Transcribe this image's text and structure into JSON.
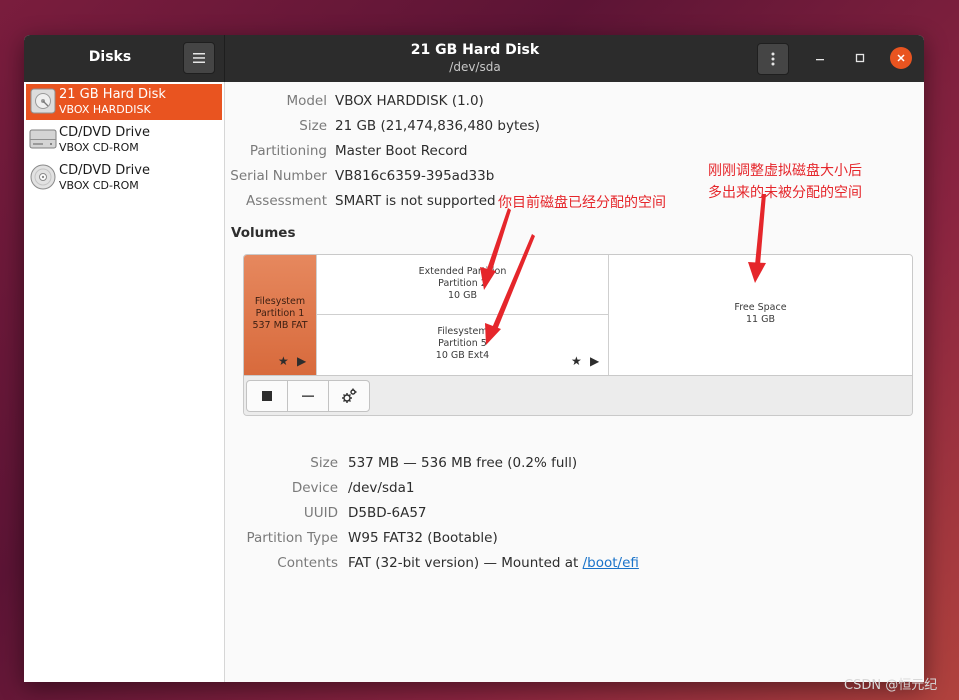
{
  "titlebar": {
    "app_title": "Disks",
    "window_title": "21 GB Hard Disk",
    "window_subtitle": "/dev/sda"
  },
  "sidebar": {
    "items": [
      {
        "name": "21 GB Hard Disk",
        "model": "VBOX HARDDISK",
        "icon": "hard-disk-icon",
        "selected": true
      },
      {
        "name": "CD/DVD Drive",
        "model": "VBOX CD-ROM",
        "icon": "optical-drive-icon",
        "selected": false
      },
      {
        "name": "CD/DVD Drive",
        "model": "VBOX CD-ROM",
        "icon": "optical-disc-icon",
        "selected": false
      }
    ]
  },
  "disk_info": [
    {
      "label": "Model",
      "value": "VBOX HARDDISK (1.0)"
    },
    {
      "label": "Size",
      "value": "21 GB (21,474,836,480 bytes)"
    },
    {
      "label": "Partitioning",
      "value": "Master Boot Record"
    },
    {
      "label": "Serial Number",
      "value": "VB816c6359-395ad33b"
    },
    {
      "label": "Assessment",
      "value": "SMART is not supported"
    }
  ],
  "volumes": {
    "title": "Volumes",
    "partition1": {
      "line1": "Filesystem",
      "line2": "Partition 1",
      "line3": "537 MB FAT"
    },
    "partition2": {
      "line1": "Extended Partition",
      "line2": "Partition 2",
      "line3": "10 GB"
    },
    "partition5": {
      "line1": "Filesystem",
      "line2": "Partition 5",
      "line3": "10 GB Ext4"
    },
    "free_space": {
      "line1": "Free Space",
      "line2": "11 GB"
    }
  },
  "volume_info": [
    {
      "label": "Size",
      "value": "537 MB — 536 MB free (0.2% full)"
    },
    {
      "label": "Device",
      "value": "/dev/sda1"
    },
    {
      "label": "UUID",
      "value": "D5BD-6A57"
    },
    {
      "label": "Partition Type",
      "value": "W95 FAT32 (Bootable)"
    },
    {
      "label": "Contents",
      "value": "FAT (32-bit version) — Mounted at ",
      "link": "/boot/efi"
    }
  ],
  "annotations": {
    "allocated": "你目前磁盘已经分配的空间",
    "unallocated_line1": "刚刚调整虚拟磁盘大小后",
    "unallocated_line2": "多出来的未被分配的空间"
  },
  "watermark": "CSDN @恒元纪",
  "colors": {
    "accent": "#e95420",
    "annotation": "#e5262b"
  }
}
